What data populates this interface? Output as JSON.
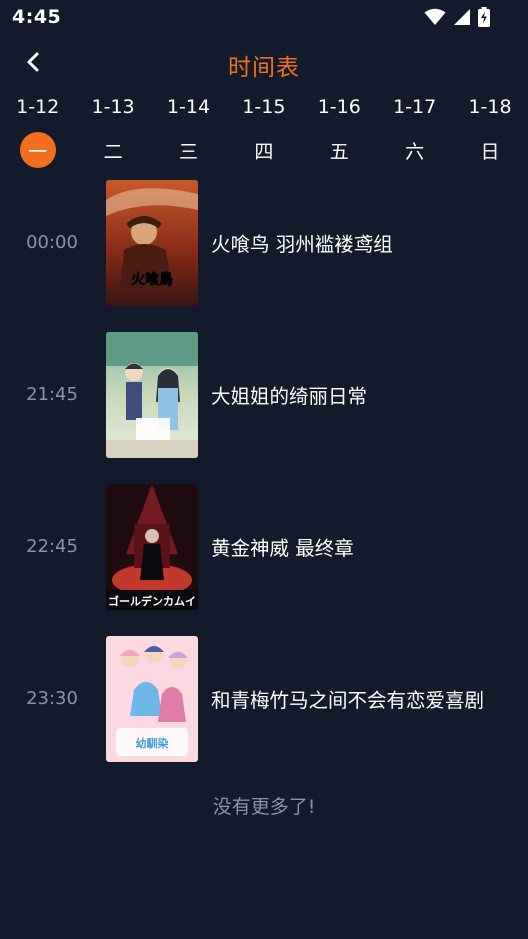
{
  "status_bar": {
    "time": "4:45",
    "icons": [
      "wifi-icon",
      "cellular-signal-icon",
      "battery-charging-icon"
    ]
  },
  "header": {
    "back_icon": "chevron-left-icon",
    "title": "时间表",
    "accent_color": "#f36f20"
  },
  "days": [
    {
      "date": "1-12",
      "weekday": "一",
      "selected": true
    },
    {
      "date": "1-13",
      "weekday": "二",
      "selected": false
    },
    {
      "date": "1-14",
      "weekday": "三",
      "selected": false
    },
    {
      "date": "1-15",
      "weekday": "四",
      "selected": false
    },
    {
      "date": "1-16",
      "weekday": "五",
      "selected": false
    },
    {
      "date": "1-17",
      "weekday": "六",
      "selected": false
    },
    {
      "date": "1-18",
      "weekday": "日",
      "selected": false
    }
  ],
  "schedule": [
    {
      "time": "00:00",
      "title": "火喰鸟 羽州褴褛鸢组"
    },
    {
      "time": "21:45",
      "title": "大姐姐的绮丽日常"
    },
    {
      "time": "22:45",
      "title": "黄金神威 最终章"
    },
    {
      "time": "23:30",
      "title": "和青梅竹马之间不会有恋爱喜剧"
    }
  ],
  "footer": {
    "end_text": "没有更多了!"
  },
  "colors": {
    "background": "#131a2b",
    "accent": "#f36f20",
    "muted_text": "#8c93a3"
  }
}
